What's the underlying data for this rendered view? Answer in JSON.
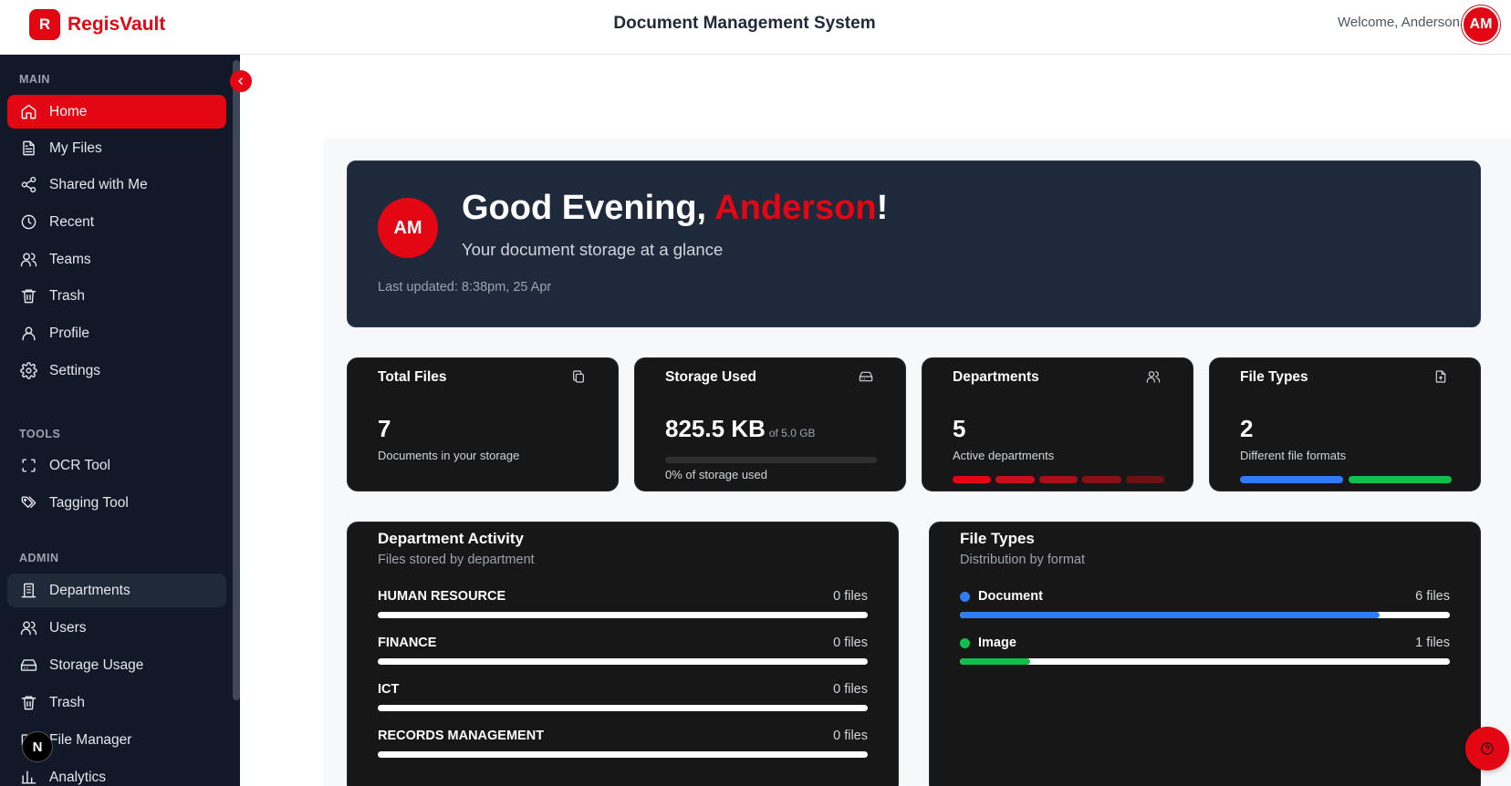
{
  "header": {
    "brand_letter": "R",
    "brand_name": "RegisVault",
    "title": "Document Management System",
    "welcome": "Welcome, Anderson",
    "avatar_initials": "AM"
  },
  "sidebar": {
    "sections": {
      "main": "MAIN",
      "tools": "TOOLS",
      "admin": "ADMIN"
    },
    "main_items": [
      {
        "label": "Home",
        "icon": "home-icon"
      },
      {
        "label": "My Files",
        "icon": "file-icon"
      },
      {
        "label": "Shared with Me",
        "icon": "share-icon"
      },
      {
        "label": "Recent",
        "icon": "clock-icon"
      },
      {
        "label": "Teams",
        "icon": "users-icon"
      },
      {
        "label": "Trash",
        "icon": "trash-icon"
      },
      {
        "label": "Profile",
        "icon": "user-icon"
      },
      {
        "label": "Settings",
        "icon": "gear-icon"
      }
    ],
    "tool_items": [
      {
        "label": "OCR Tool",
        "icon": "scan-icon"
      },
      {
        "label": "Tagging Tool",
        "icon": "tags-icon"
      }
    ],
    "admin_items": [
      {
        "label": "Departments",
        "icon": "building-icon"
      },
      {
        "label": "Users",
        "icon": "users-icon"
      },
      {
        "label": "Storage Usage",
        "icon": "hard-drive-icon"
      },
      {
        "label": "Trash",
        "icon": "trash-icon"
      },
      {
        "label": "File Manager",
        "icon": "folder-icon"
      },
      {
        "label": "Analytics",
        "icon": "bar-chart-icon"
      }
    ],
    "next_badge": "N"
  },
  "hero": {
    "avatar_initials": "AM",
    "greeting_prefix": "Good Evening, ",
    "greeting_name": "Anderson",
    "greeting_suffix": "!",
    "subtitle": "Your document storage at a glance",
    "last_updated": "Last updated: 8:38pm, 25 Apr"
  },
  "stats": {
    "total_files": {
      "title": "Total Files",
      "value": "7",
      "desc": "Documents in your storage",
      "icon": "copy-icon"
    },
    "storage_used": {
      "title": "Storage Used",
      "value": "825.5 KB",
      "of_total": "of 5.0 GB",
      "desc": "0% of storage used",
      "percent": 0,
      "icon": "hard-drive-icon"
    },
    "departments": {
      "title": "Departments",
      "value": "5",
      "desc": "Active departments",
      "icon": "users-icon",
      "segment_colors": [
        "#e30613",
        "#c8101a",
        "#a80f16",
        "#8b1015",
        "#6e1013"
      ]
    },
    "file_types": {
      "title": "File Types",
      "value": "2",
      "desc": "Different file formats",
      "icon": "file-type-icon",
      "segment_colors": [
        "#2f7cf6",
        "#10c04a"
      ]
    }
  },
  "department_activity": {
    "title": "Department Activity",
    "subtitle": "Files stored by department",
    "rows": [
      {
        "name": "HUMAN RESOURCE",
        "count": "0 files",
        "fraction": 0
      },
      {
        "name": "FINANCE",
        "count": "0 files",
        "fraction": 0
      },
      {
        "name": "ICT",
        "count": "0 files",
        "fraction": 0
      },
      {
        "name": "RECORDS MANAGEMENT",
        "count": "0 files",
        "fraction": 0
      }
    ]
  },
  "file_types_panel": {
    "title": "File Types",
    "subtitle": "Distribution by format",
    "rows": [
      {
        "name": "Document",
        "count": "6 files",
        "fraction": 0.857,
        "color": "#2f7cf6"
      },
      {
        "name": "Image",
        "count": "1 files",
        "fraction": 0.143,
        "color": "#10c04a"
      }
    ]
  },
  "colors": {
    "accent": "#e30613",
    "sidebar_bg": "#111827",
    "hero_bg": "#1e293b",
    "card_bg": "#171717"
  }
}
